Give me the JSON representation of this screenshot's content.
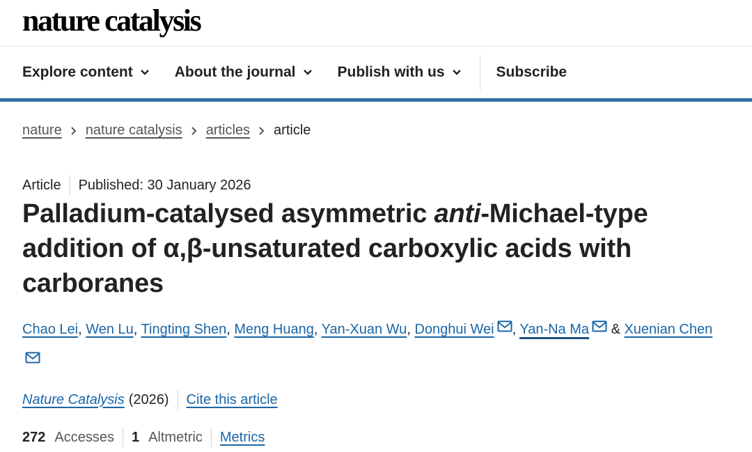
{
  "brand": {
    "logo_text": "nature catalysis"
  },
  "nav": {
    "items": [
      {
        "label": "Explore content",
        "has_dropdown": true
      },
      {
        "label": "About the journal",
        "has_dropdown": true
      },
      {
        "label": "Publish with us",
        "has_dropdown": true
      }
    ],
    "subscribe_label": "Subscribe"
  },
  "breadcrumb": {
    "items": [
      "nature",
      "nature catalysis",
      "articles"
    ],
    "current": "article"
  },
  "article": {
    "type": "Article",
    "published": "Published: 30 January 2026",
    "title_part1": "Palladium-catalysed asymmetric ",
    "title_italic": "anti",
    "title_part2": "-Michael-type addition of α,β-unsaturated carboxylic acids with carboranes",
    "authors": [
      {
        "name": "Chao Lei",
        "corresponding": false
      },
      {
        "name": "Wen Lu",
        "corresponding": false
      },
      {
        "name": "Tingting Shen",
        "corresponding": false
      },
      {
        "name": "Meng Huang",
        "corresponding": false
      },
      {
        "name": "Yan-Xuan Wu",
        "corresponding": false
      },
      {
        "name": "Donghui Wei",
        "corresponding": true
      },
      {
        "name": "Yan-Na Ma",
        "corresponding": true
      },
      {
        "name": "Xuenian Chen",
        "corresponding": true
      }
    ],
    "author_sep": ", ",
    "author_and": " & ",
    "journal": "Nature Catalysis",
    "year": "(2026)",
    "cite_label": "Cite this article",
    "metrics": {
      "accesses_value": "272",
      "accesses_label": "Accesses",
      "altmetric_value": "1",
      "altmetric_label": "Altmetric",
      "metrics_link": "Metrics"
    }
  },
  "colors": {
    "accent": "#336ea6",
    "link": "#1a66a8"
  },
  "icons": {
    "dropdown": "chevron-down-icon",
    "breadcrumb_sep": "chevron-right-icon",
    "email": "mail-icon"
  }
}
